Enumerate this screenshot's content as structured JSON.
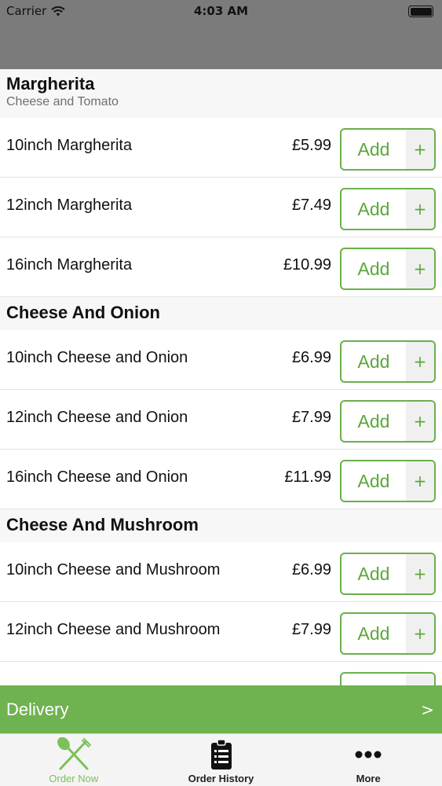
{
  "status_bar": {
    "carrier": "Carrier",
    "time": "4:03 AM"
  },
  "sections": [
    {
      "title": "Margherita",
      "subtitle": "Cheese and Tomato",
      "items": [
        {
          "name": "10inch Margherita",
          "price": "£5.99"
        },
        {
          "name": "12inch Margherita",
          "price": "£7.49"
        },
        {
          "name": "16inch Margherita",
          "price": "£10.99"
        }
      ]
    },
    {
      "title": "Cheese And Onion",
      "items": [
        {
          "name": "10inch Cheese and Onion",
          "price": "£6.99"
        },
        {
          "name": "12inch Cheese and Onion",
          "price": "£7.99"
        },
        {
          "name": "16inch Cheese and Onion",
          "price": "£11.99"
        }
      ]
    },
    {
      "title": "Cheese And Mushroom",
      "items": [
        {
          "name": "10inch Cheese and Mushroom",
          "price": "£6.99"
        },
        {
          "name": "12inch Cheese and Mushroom",
          "price": "£7.99"
        },
        {
          "name": "",
          "price": ""
        }
      ]
    }
  ],
  "add_button": {
    "label": "Add",
    "plus": "+"
  },
  "delivery_bar": {
    "label": "Delivery",
    "chevron": ">"
  },
  "tabs": [
    {
      "label": "Order Now",
      "icon": "fork-knife-icon",
      "active": true
    },
    {
      "label": "Order History",
      "icon": "clipboard-icon",
      "active": false
    },
    {
      "label": "More",
      "icon": "more-dots-icon",
      "active": false
    }
  ],
  "colors": {
    "accent": "#6fb250",
    "header_gray": "#7b7b7b",
    "section_bg": "#f7f7f7"
  }
}
